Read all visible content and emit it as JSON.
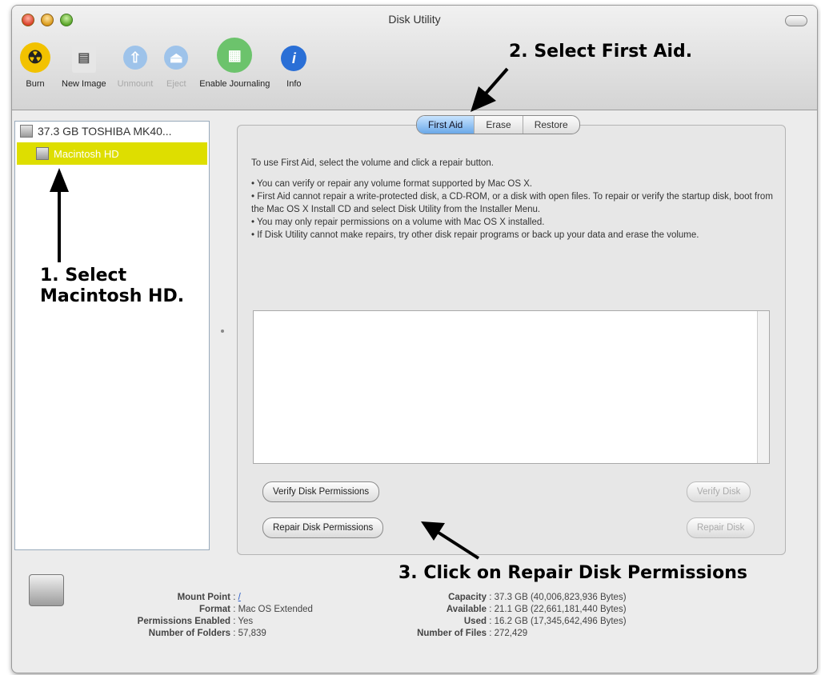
{
  "window": {
    "title": "Disk Utility"
  },
  "toolbar": {
    "items": [
      {
        "label": "Burn",
        "icon": "burn-icon",
        "enabled": true,
        "color": "#f2c200"
      },
      {
        "label": "New Image",
        "icon": "new-image-icon",
        "enabled": true,
        "color": "#e6e6e6"
      },
      {
        "label": "Unmount",
        "icon": "unmount-icon",
        "enabled": false,
        "color": "#9ec3ea"
      },
      {
        "label": "Eject",
        "icon": "eject-icon",
        "enabled": false,
        "color": "#9ec3ea"
      },
      {
        "label": "Enable Journaling",
        "icon": "journaling-icon",
        "enabled": true,
        "color": "#6cc36c"
      },
      {
        "label": "Info",
        "icon": "info-icon",
        "enabled": true,
        "color": "#2a6fd6"
      }
    ]
  },
  "sidebar": {
    "disk": "37.3 GB TOSHIBA MK40...",
    "volume": "Macintosh HD",
    "selected_color": "#dede00"
  },
  "tabs": [
    "First Aid",
    "Erase",
    "Restore"
  ],
  "active_tab": "First Aid",
  "first_aid": {
    "intro": "To use First Aid, select the volume and click a repair button.",
    "bullets": [
      "• You can verify or repair any volume format supported by Mac OS X.",
      "• First Aid cannot repair a write-protected disk, a CD-ROM, or a disk with open files. To repair or verify the startup disk, boot from the Mac OS X Install CD and select Disk Utility from the Installer Menu.",
      "• You may only repair permissions on a volume with Mac OS X installed.",
      "• If Disk Utility cannot make repairs, try other disk repair programs or back up your data and erase the volume."
    ],
    "verify_permissions": "Verify Disk Permissions",
    "repair_permissions": "Repair Disk Permissions",
    "verify_disk": "Verify Disk",
    "repair_disk": "Repair Disk"
  },
  "annotations": {
    "step1_line1": "1.  Select",
    "step1_line2": "Macintosh HD.",
    "step2": "2. Select First Aid.",
    "step3": "3. Click on Repair Disk Permissions"
  },
  "info": {
    "left": [
      {
        "k": "Mount Point",
        "v": "/"
      },
      {
        "k": "Format",
        "v": "Mac OS Extended"
      },
      {
        "k": "Permissions Enabled",
        "v": "Yes"
      },
      {
        "k": "Number of Folders",
        "v": "57,839"
      }
    ],
    "right": [
      {
        "k": "Capacity",
        "v": "37.3 GB (40,006,823,936 Bytes)"
      },
      {
        "k": "Available",
        "v": "21.1 GB (22,661,181,440 Bytes)"
      },
      {
        "k": "Used",
        "v": "16.2 GB (17,345,642,496 Bytes)"
      },
      {
        "k": "Number of Files",
        "v": "272,429"
      }
    ]
  }
}
